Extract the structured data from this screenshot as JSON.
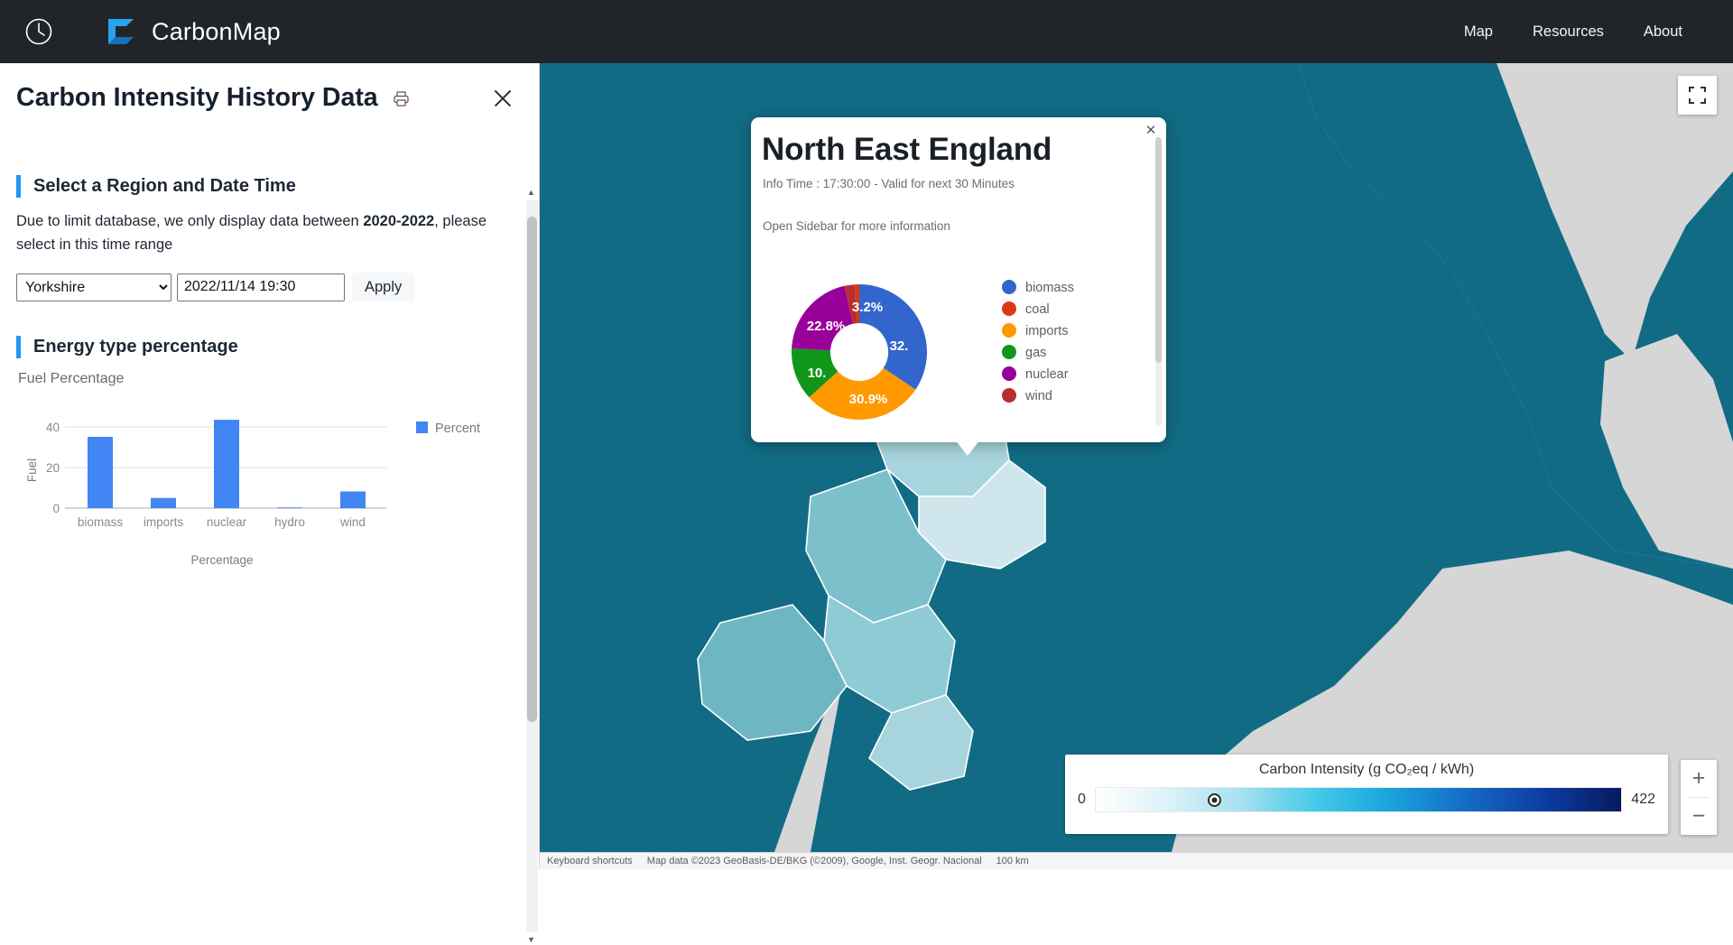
{
  "navbar": {
    "clock_icon": "clock-icon",
    "brand_icon": "carbonmap-logo-icon",
    "brand": "CarbonMap",
    "links": [
      {
        "label": "Map"
      },
      {
        "label": "Resources"
      },
      {
        "label": "About"
      }
    ]
  },
  "sidebar": {
    "title": "Carbon Intensity History Data",
    "print_icon": "printer-icon",
    "close_icon": "close-icon",
    "section1": {
      "title": "Select a Region and Date Time",
      "note_prefix": "Due to limit database, we only display data between ",
      "note_bold": "2020-2022",
      "note_suffix": ", please select in this time range",
      "region_selected": "Yorkshire",
      "region_options": [
        "Yorkshire"
      ],
      "datetime_value": "2022/11/14 19:30",
      "apply_label": "Apply"
    },
    "section2": {
      "title": "Energy type percentage",
      "subtitle": "Fuel Percentage"
    },
    "scrollbar": {
      "up_arrow": "▲",
      "down_arrow": "▼"
    }
  },
  "chart_data": [
    {
      "type": "bar",
      "title": "Fuel Percentage",
      "categories": [
        "biomass",
        "imports",
        "nuclear",
        "hydro",
        "wind"
      ],
      "values": [
        35.1,
        5.0,
        43.5,
        0.3,
        8.2
      ],
      "series": [
        {
          "name": "Percent",
          "values": [
            35.1,
            5.0,
            43.5,
            0.3,
            8.2
          ]
        }
      ],
      "xlabel": "Percentage",
      "ylabel": "Fuel",
      "ylim": [
        0,
        48
      ],
      "yticks": [
        0,
        20,
        40
      ],
      "grid": true,
      "legend": [
        "Percent"
      ],
      "legend_position": "right",
      "color": "#4285f4"
    },
    {
      "type": "pie",
      "title": "North East England fuel mix",
      "donut": true,
      "labels": [
        "biomass",
        "coal",
        "imports",
        "gas",
        "nuclear",
        "wind"
      ],
      "values": [
        32.0,
        0.7,
        30.9,
        10.4,
        22.8,
        3.2
      ],
      "display_labels": [
        "32.",
        "",
        "30.9%",
        "10.",
        "22.8%",
        "3.2%"
      ],
      "colors": [
        "#3366cc",
        "#dc3912",
        "#ff9900",
        "#109618",
        "#990099",
        "#b82e2e"
      ],
      "legend_position": "right"
    }
  ],
  "popup": {
    "title": "North East England",
    "subtitle": "Info Time : 17:30:00 - Valid for next 30 Minutes",
    "hint": "Open Sidebar for more information",
    "close_icon": "close-icon"
  },
  "map": {
    "fullscreen_icon": "fullscreen-icon",
    "zoom_in": "+",
    "zoom_out": "−",
    "footer": {
      "keyboard_shortcuts": "Keyboard shortcuts",
      "attribution": "Map data ©2023 GeoBasis-DE/BKG (©2009), Google, Inst. Geogr. Nacional",
      "scale": "100 km"
    },
    "land_color": "#d6d6d6",
    "water_color": "#116b84"
  },
  "scale_legend": {
    "title": "Carbon Intensity (g CO₂eq / kWh)",
    "min": "0",
    "max": "422",
    "marker_position_pct": 22.5
  }
}
